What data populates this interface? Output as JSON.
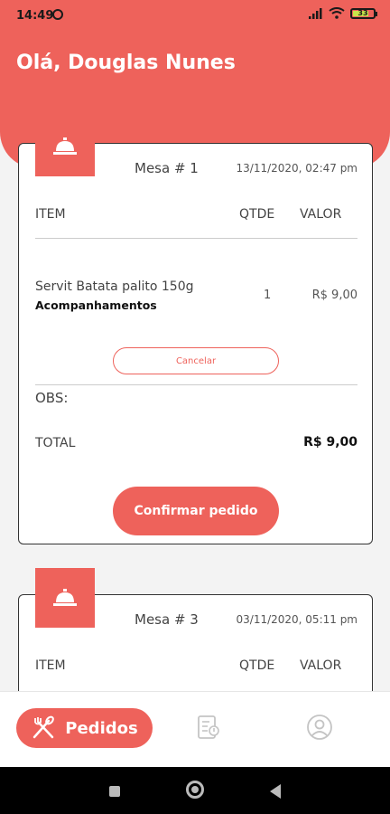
{
  "status": {
    "time": "14:49",
    "battery": "33"
  },
  "header": {
    "greeting": "Olá, Douglas Nunes"
  },
  "orders": [
    {
      "mesa": "Mesa # 1",
      "date": "13/11/2020, 02:47 pm",
      "columns": {
        "item": "ITEM",
        "qtde": "QTDE",
        "valor": "VALOR"
      },
      "items": [
        {
          "name": "Servit Batata palito 150g",
          "category": "Acompanhamentos",
          "qty": "1",
          "value": "R$ 9,00"
        }
      ],
      "cancel_label": "Cancelar",
      "obs_label": "OBS:",
      "total_label": "TOTAL",
      "total_value": "R$ 9,00",
      "confirm_label": "Confirmar pedido"
    },
    {
      "mesa": "Mesa # 3",
      "date": "03/11/2020, 05:11 pm",
      "columns": {
        "item": "ITEM",
        "qtde": "QTDE",
        "valor": "VALOR"
      }
    }
  ],
  "bottom_nav": {
    "pedidos_label": "Pedidos",
    "icons": [
      "utensils-icon",
      "order-list-icon",
      "profile-icon"
    ]
  },
  "colors": {
    "accent": "#ee625b",
    "dark": "#1a1a1a"
  }
}
